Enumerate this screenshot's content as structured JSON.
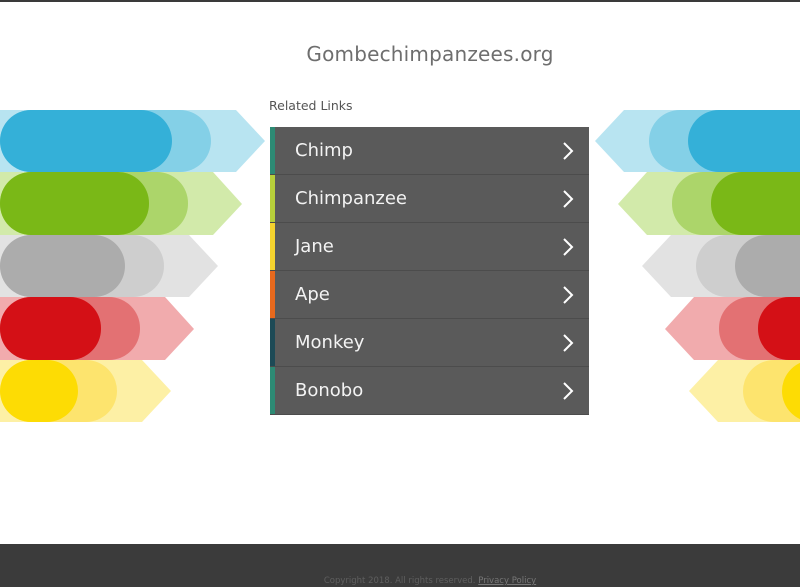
{
  "header": {
    "domain": "Gombechimpanzees.org"
  },
  "related": {
    "heading": "Related Links"
  },
  "links": [
    {
      "label": "Chimp",
      "accent": "#2d8a74"
    },
    {
      "label": "Chimpanzee",
      "accent": "#b7cf3a"
    },
    {
      "label": "Jane",
      "accent": "#f5d32e"
    },
    {
      "label": "Ape",
      "accent": "#e8691d"
    },
    {
      "label": "Monkey",
      "accent": "#1d4a56"
    },
    {
      "label": "Bonobo",
      "accent": "#2d8a74"
    }
  ],
  "deco_colors": {
    "blue": [
      "#34b0d8",
      "#84d0e7",
      "#b8e4f1"
    ],
    "green": [
      "#7ab817",
      "#acd56a",
      "#d2eaaa"
    ],
    "gray": [
      "#acacac",
      "#cecece",
      "#e2e2e2"
    ],
    "red": [
      "#d41016",
      "#e37173",
      "#f1abad"
    ],
    "yellow": [
      "#fddc04",
      "#fde46e",
      "#fdf0a5"
    ]
  },
  "footer": {
    "copyright": "Copyright 2018. All rights reserved.",
    "privacy": "Privacy Policy"
  }
}
